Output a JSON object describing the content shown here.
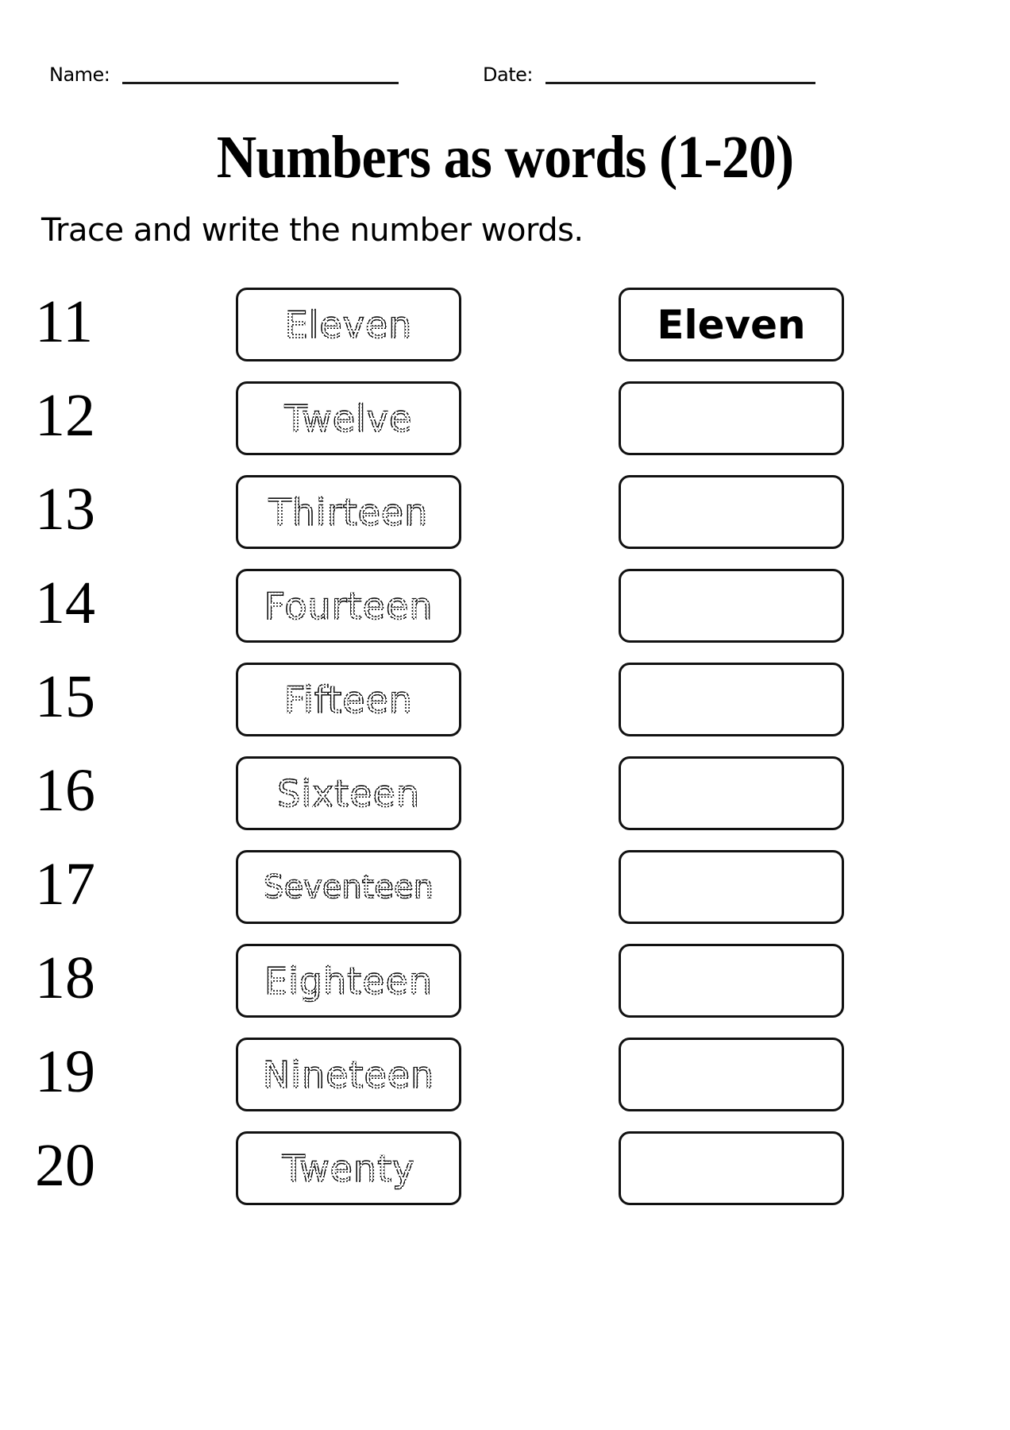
{
  "header": {
    "name_label": "Name:",
    "date_label": "Date:",
    "name_value": "",
    "date_value": ""
  },
  "title": "Numbers as words (1-20)",
  "instruction": "Trace and write the number words.",
  "rows": [
    {
      "numeral": "11",
      "trace_word": "Eleven",
      "answer_word": "Eleven"
    },
    {
      "numeral": "12",
      "trace_word": "Twelve",
      "answer_word": ""
    },
    {
      "numeral": "13",
      "trace_word": "Thirteen",
      "answer_word": ""
    },
    {
      "numeral": "14",
      "trace_word": "Fourteen",
      "answer_word": ""
    },
    {
      "numeral": "15",
      "trace_word": "Fifteen",
      "answer_word": ""
    },
    {
      "numeral": "16",
      "trace_word": "Sixteen",
      "answer_word": ""
    },
    {
      "numeral": "17",
      "trace_word": "Seventeen",
      "answer_word": ""
    },
    {
      "numeral": "18",
      "trace_word": "Eighteen",
      "answer_word": ""
    },
    {
      "numeral": "19",
      "trace_word": "Nineteen",
      "answer_word": ""
    },
    {
      "numeral": "20",
      "trace_word": "Twenty",
      "answer_word": ""
    }
  ]
}
